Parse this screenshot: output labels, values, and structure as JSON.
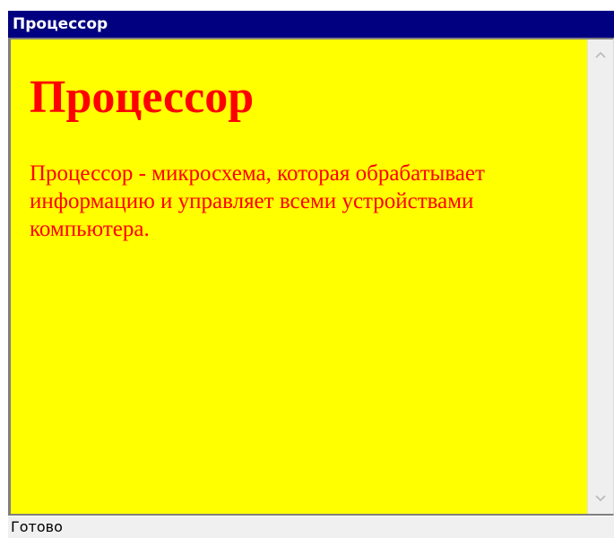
{
  "window": {
    "title": "Процессор"
  },
  "document": {
    "heading": "Процессор",
    "paragraph": "Процессор - микросхема, которая обрабатывает информацию и управляет всеми устройствами компьютера.",
    "background_color": "#ffff00",
    "text_color": "#ff0000"
  },
  "scrollbar": {
    "up_icon": "chevron-up-icon",
    "down_icon": "chevron-down-icon"
  },
  "status": {
    "text": "Готово"
  },
  "colors": {
    "titlebar": "#000080",
    "statusbar": "#f0f0f0"
  }
}
